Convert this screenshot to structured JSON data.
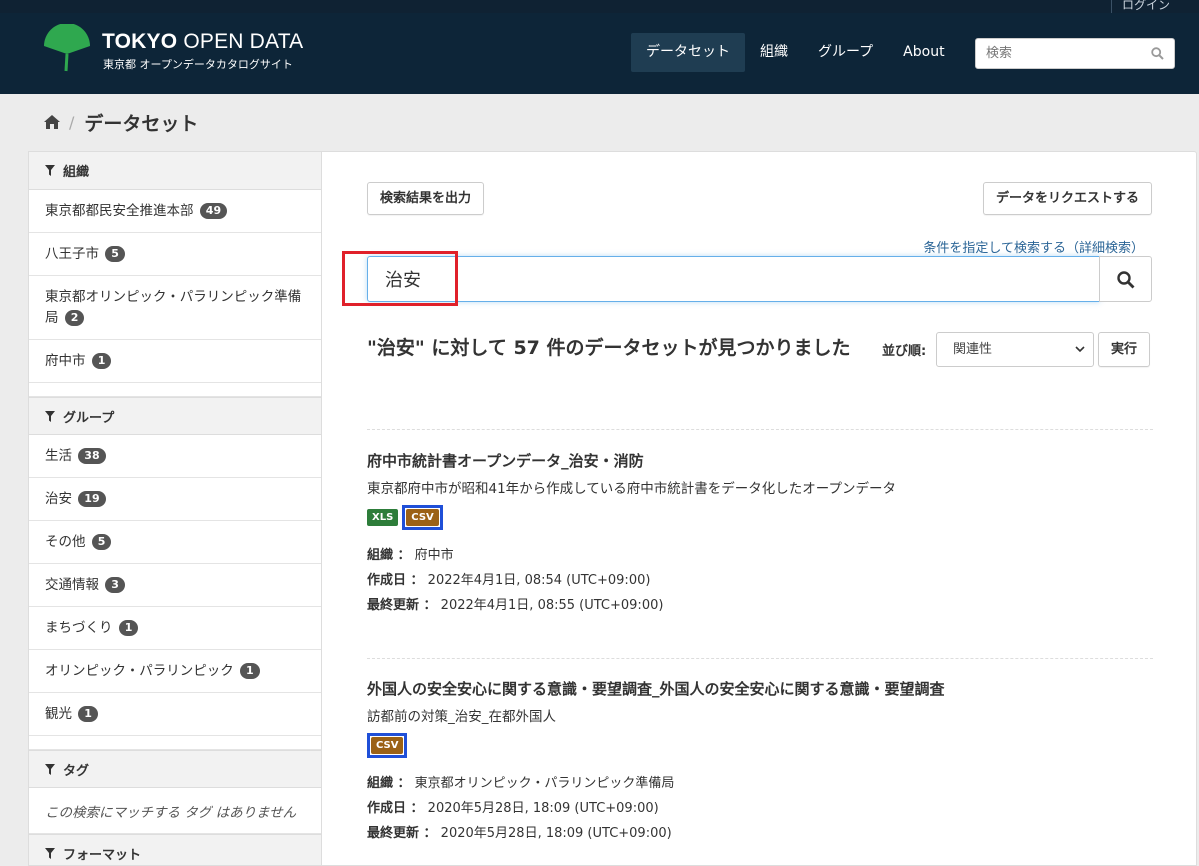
{
  "header": {
    "login_label": "ログイン",
    "logo_title_bold": "TOKYO",
    "logo_title_rest": " OPEN DATA",
    "logo_subtitle": "東京都 オープンデータカタログサイト",
    "nav": [
      {
        "label": "データセット",
        "active": true
      },
      {
        "label": "組織",
        "active": false
      },
      {
        "label": "グループ",
        "active": false
      },
      {
        "label": "About",
        "active": false
      }
    ],
    "search_placeholder": "検索"
  },
  "breadcrumb": {
    "current": "データセット"
  },
  "sidebar": {
    "organizations": {
      "heading": "組織",
      "items": [
        {
          "label": "東京都都民安全推進本部",
          "count": "49"
        },
        {
          "label": "八王子市",
          "count": "5"
        },
        {
          "label": "東京都オリンピック・パラリンピック準備局",
          "count": "2"
        },
        {
          "label": "府中市",
          "count": "1"
        }
      ]
    },
    "groups": {
      "heading": "グループ",
      "items": [
        {
          "label": "生活",
          "count": "38"
        },
        {
          "label": "治安",
          "count": "19"
        },
        {
          "label": "その他",
          "count": "5"
        },
        {
          "label": "交通情報",
          "count": "3"
        },
        {
          "label": "まちづくり",
          "count": "1"
        },
        {
          "label": "オリンピック・パラリンピック",
          "count": "1"
        },
        {
          "label": "観光",
          "count": "1"
        }
      ]
    },
    "tags": {
      "heading": "タグ",
      "empty": "この検索にマッチする タグ はありません"
    },
    "formats": {
      "heading": "フォーマット"
    }
  },
  "main": {
    "export_button": "検索結果を出力",
    "request_button": "データをリクエストする",
    "advanced_search_link": "条件を指定して検索する（詳細検索）",
    "search_value": "治安",
    "result_heading": "\"治安\" に対して 57 件のデータセットが見つかりました",
    "sort_label": "並び順:",
    "sort_selected": "関連性",
    "go_button": "実行",
    "datasets": [
      {
        "title": "府中市統計書オープンデータ_治安・消防",
        "notes": "東京都府中市が昭和41年から作成している府中市統計書をデータ化したオープンデータ",
        "formats": [
          "XLS",
          "CSV"
        ],
        "org_label": "組織 ：",
        "org": "府中市",
        "created_label": "作成日 ：",
        "created": "2022年4月1日, 08:54 (UTC+09:00)",
        "updated_label": "最終更新 ：",
        "updated": "2022年4月1日, 08:55 (UTC+09:00)"
      },
      {
        "title": "外国人の安全安心に関する意識・要望調査_外国人の安全安心に関する意識・要望調査",
        "notes": "訪都前の対策_治安_在都外国人",
        "formats": [
          "CSV"
        ],
        "org_label": "組織 ：",
        "org": "東京都オリンピック・パラリンピック準備局",
        "created_label": "作成日 ：",
        "created": "2020年5月28日, 18:09 (UTC+09:00)",
        "updated_label": "最終更新 ：",
        "updated": "2020年5月28日, 18:09 (UTC+09:00)"
      }
    ]
  },
  "colors": {
    "header_bg": "#0d2538",
    "nav_active_bg": "#1f3d52",
    "xls_badge": "#2d7d3a",
    "csv_badge": "#9b6116",
    "highlight_red": "#e0202a",
    "highlight_blue": "#1f4fd8",
    "link": "#2a6496"
  }
}
